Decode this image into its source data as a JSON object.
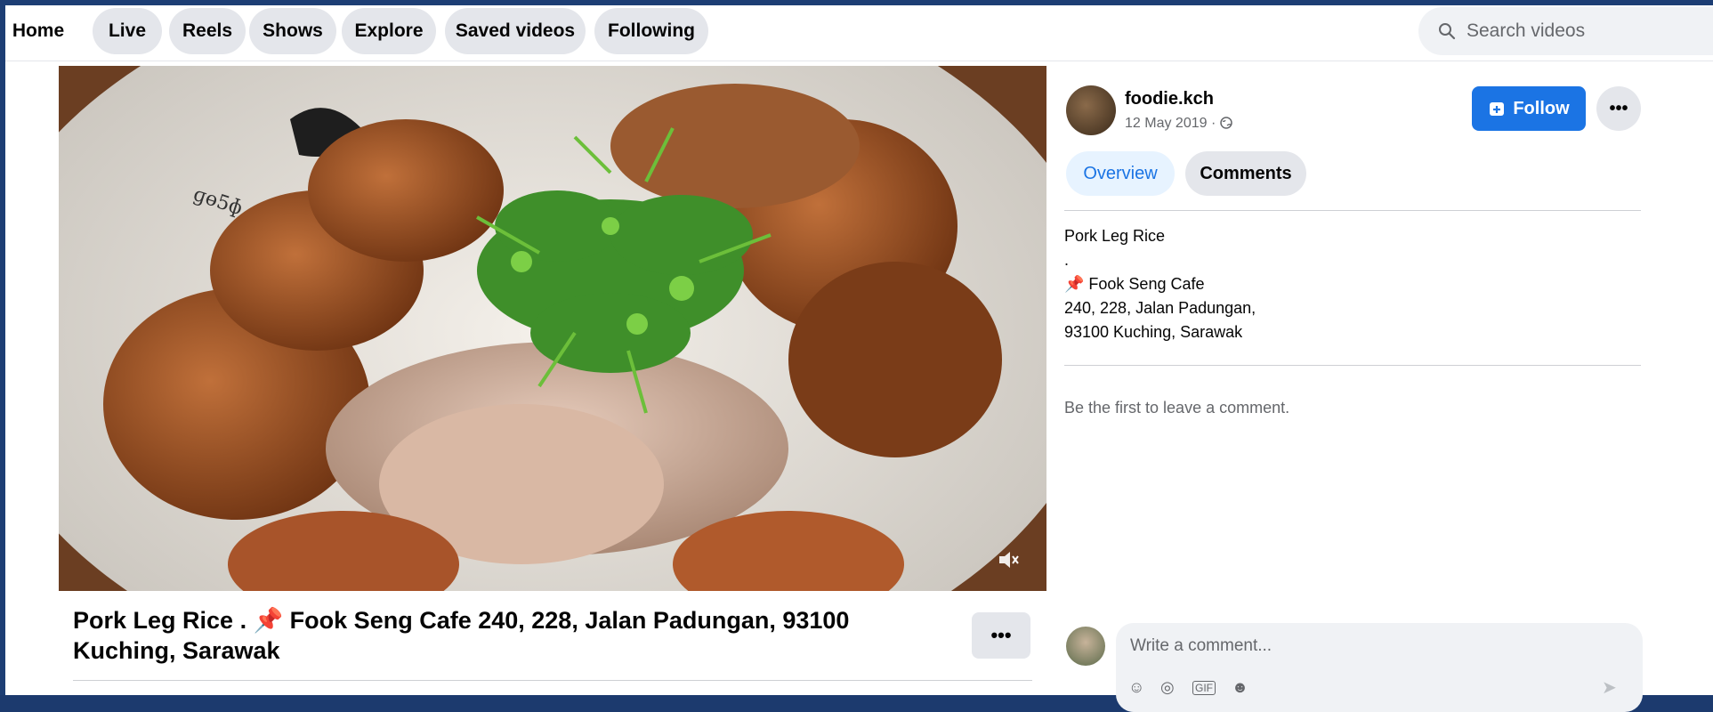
{
  "nav": {
    "tabs": [
      "Home",
      "Live",
      "Reels",
      "Shows",
      "Explore",
      "Saved videos",
      "Following"
    ],
    "search_placeholder": "Search videos"
  },
  "video": {
    "title": "Pork Leg Rice . 📌 Fook Seng Cafe 240, 228, Jalan Padungan, 93100 Kuching, Sarawak",
    "mute_icon": "volume-muted-icon",
    "more_label": "•••"
  },
  "post": {
    "author": "foodie.kch",
    "date": "12 May 2019 ·",
    "privacy_icon": "globe-icon",
    "follow_label": "Follow",
    "more_label": "•••",
    "tabs": {
      "overview": "Overview",
      "comments": "Comments"
    },
    "description": [
      "Pork Leg Rice",
      ".",
      "📌 Fook Seng Cafe",
      "240, 228, Jalan Padungan,",
      "93100 Kuching, Sarawak"
    ],
    "no_comments_text": "Be the first to leave a comment."
  },
  "composer": {
    "placeholder": "Write a comment...",
    "icons": [
      "emoji-icon",
      "camera-icon",
      "gif-icon",
      "sticker-icon",
      "send-icon"
    ]
  },
  "colors": {
    "accent": "#1b74e4",
    "pill_bg": "#e4e6eb",
    "border_dark": "#1d3e74"
  }
}
